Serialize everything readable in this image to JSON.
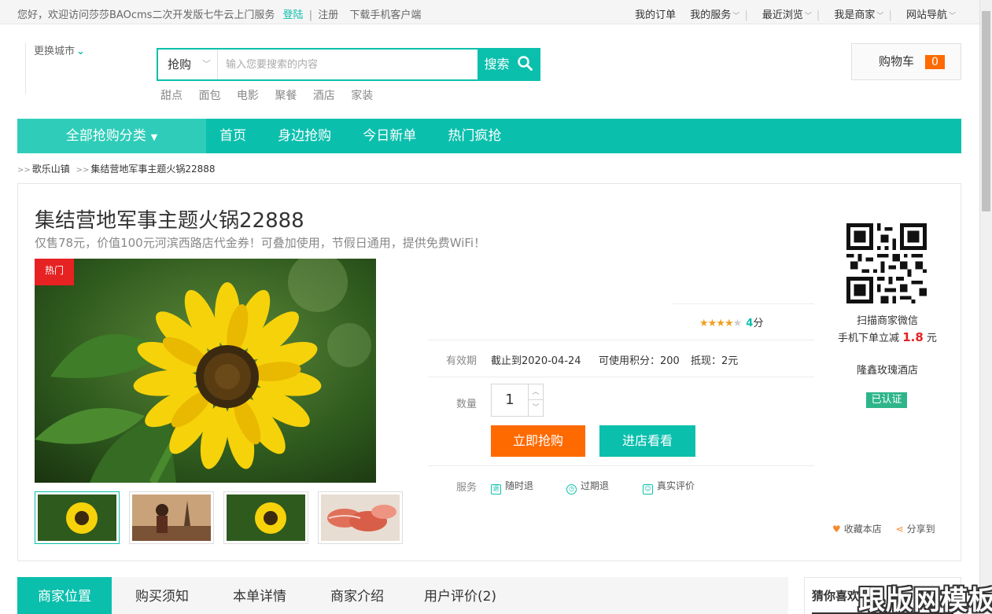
{
  "topbar": {
    "welcome": "您好，欢迎访问莎莎BAOcms二次开发版七牛云上门服务",
    "login": "登陆",
    "separator": "|",
    "register": "注册",
    "app": "下载手机客户端",
    "links": [
      "我的订单",
      "我的服务",
      "最近浏览",
      "我是商家",
      "网站导航"
    ]
  },
  "city": {
    "label": "更换城市"
  },
  "search": {
    "category": "抢购",
    "placeholder": "输入您要搜索的内容",
    "button": "搜索",
    "hot": [
      "甜点",
      "面包",
      "电影",
      "聚餐",
      "酒店",
      "家装"
    ]
  },
  "cart": {
    "label": "购物车",
    "count": "0"
  },
  "nav": {
    "all": "全部抢购分类",
    "links": [
      "首页",
      "身边抢购",
      "今日新单",
      "热门疯抢"
    ]
  },
  "breadcrumb": {
    "arrow": ">>",
    "town": "歌乐山镇",
    "item": "集结营地军事主题火锅22888"
  },
  "product": {
    "title": "集结营地军事主题火锅22888",
    "subtitle": "仅售78元，价值100元河滨西路店代金券！可叠加使用，节假日通用，提供免费WiFi！",
    "badge": "热门",
    "rating": {
      "value": 4,
      "max": 5,
      "score": "4",
      "unit": "分"
    },
    "validity_label": "有效期",
    "validity": "截止到2020-04-24",
    "points": "可使用积分：200",
    "cash": "抵现：2元",
    "qty_label": "数量",
    "qty": "1",
    "buy": "立即抢购",
    "visit": "进店看看",
    "service_label": "服务",
    "services": [
      "随时退",
      "过期退",
      "真实评价"
    ]
  },
  "merchant": {
    "scan": "扫描商家微信",
    "discount_prefix": "手机下单立减",
    "discount": "1.8",
    "discount_unit": "元",
    "name": "隆鑫玫瑰酒店",
    "verified": "已认证",
    "fav": "收藏本店",
    "share": "分享到"
  },
  "tabs": [
    "商家位置",
    "购买须知",
    "本单详情",
    "商家介绍",
    "用户评价(2)"
  ],
  "guess": {
    "title": "猜你喜欢"
  },
  "watermark": "跟版网模板",
  "colors": {
    "accent": "#0bbfad",
    "orange": "#ff6a00",
    "red": "#e62222",
    "verified": "#2fb58a"
  },
  "icons": [
    "chevron-down-icon",
    "search-icon",
    "star-icon",
    "refund-icon",
    "clock-icon",
    "user-icon",
    "heart-icon",
    "share-icon",
    "qr-code"
  ]
}
